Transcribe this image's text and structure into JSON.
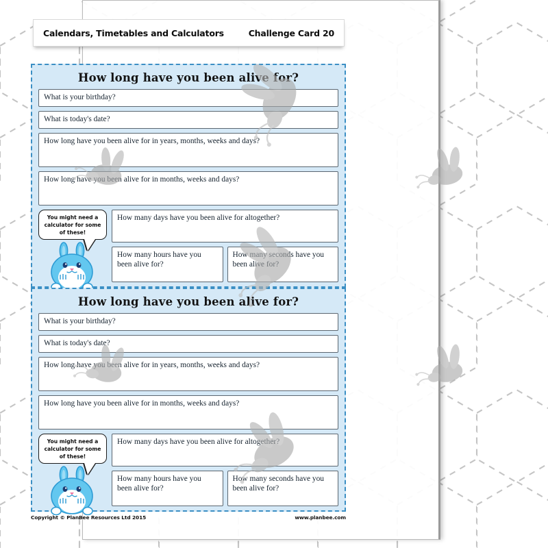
{
  "header": {
    "topic_title": "Calendars, Timetables and Calculators",
    "card_number_label": "Challenge Card 20"
  },
  "footer": {
    "copyright": "Copyright © PlanBee Resources Ltd 2015",
    "website": "www.planbee.com"
  },
  "cards": [
    {
      "title": "How long have you been alive for?",
      "questions": {
        "birthday": "What is your birthday?",
        "today": "What is today's date?",
        "years_months_weeks_days": "How long have you been alive for in years, months, weeks and days?",
        "months_weeks_days": "How long have you been alive for in months, weeks and days?",
        "days_altogether": "How many days have you been alive for altogether?",
        "hours": "How many hours have you been alive for?",
        "seconds": "How many seconds have you been alive for?"
      },
      "hint": "You might need a calculator for some of these!"
    },
    {
      "title": "How long have you been alive for?",
      "questions": {
        "birthday": "What is your birthday?",
        "today": "What is today's date?",
        "years_months_weeks_days": "How long have you been alive for in years, months, weeks and days?",
        "months_weeks_days": "How long have you been alive for in months, weeks and days?",
        "days_altogether": "How many days have you been alive for altogether?",
        "hours": "How many hours have you been alive for?",
        "seconds": "How many seconds have you been alive for?"
      },
      "hint": "You might need a calculator for some of these!"
    }
  ],
  "colors": {
    "card_background": "#d5e9f7",
    "card_border": "#3b8fc4",
    "question_border": "#5b6670",
    "page_background": "#ffffff",
    "hex_pattern": "#c9c9c9",
    "bunny_body": "#63c7ef",
    "bunny_watermark": "#b0b0b0"
  }
}
